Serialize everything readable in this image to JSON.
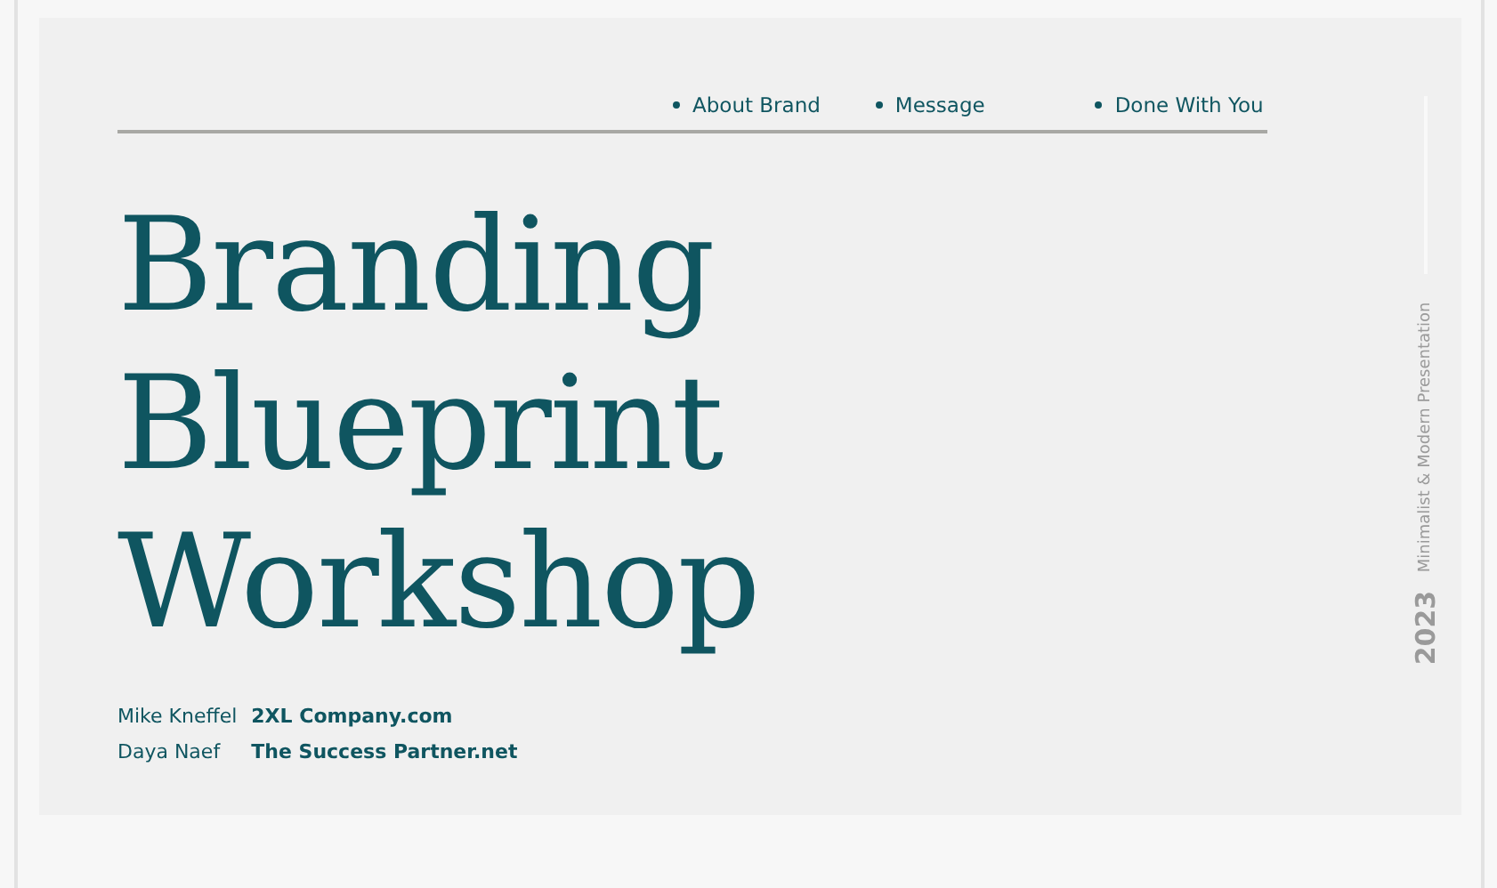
{
  "nav": {
    "items": [
      "About Brand",
      "Message",
      "Done With You"
    ]
  },
  "title": {
    "lines": [
      "Branding",
      "Blueprint",
      "Workshop"
    ]
  },
  "credits": [
    {
      "name": "Mike Kneffel",
      "company": "2XL Company.com"
    },
    {
      "name": "Daya Naef",
      "company": "The Success Partner.net"
    }
  ],
  "side": {
    "year": "2023",
    "caption": "Minimalist & Modern Presentation"
  }
}
